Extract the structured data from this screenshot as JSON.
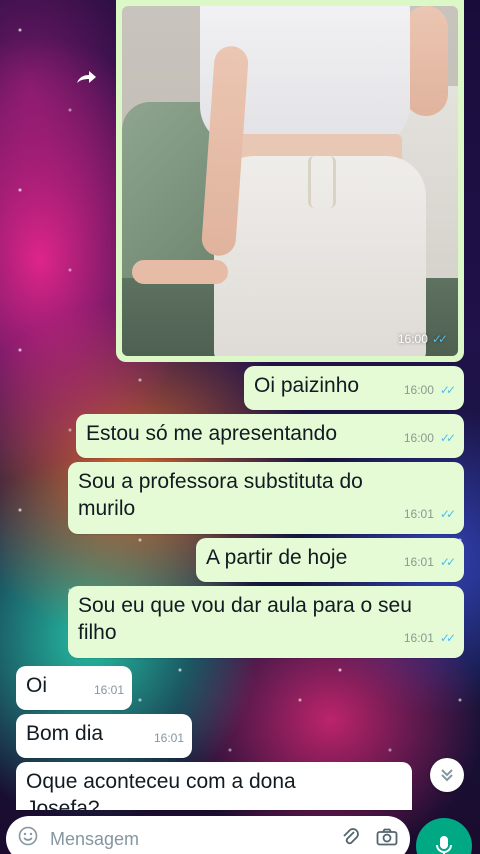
{
  "media_message": {
    "time": "16:00",
    "status_icon": "double-check-read-icon"
  },
  "messages": [
    {
      "direction": "out",
      "text": "Oi paizinho",
      "time": "16:00",
      "status": "read"
    },
    {
      "direction": "out",
      "text": "Estou só me apresentando",
      "time": "16:00",
      "status": "read"
    },
    {
      "direction": "out",
      "text": "Sou a professora substituta do murilo",
      "time": "16:01",
      "status": "read"
    },
    {
      "direction": "out",
      "text": "A partir de hoje",
      "time": "16:01",
      "status": "read"
    },
    {
      "direction": "out",
      "text": "Sou eu que vou dar aula para o seu filho",
      "time": "16:01",
      "status": "read"
    },
    {
      "direction": "in",
      "text": "Oi",
      "time": "16:01"
    },
    {
      "direction": "in",
      "text": "Bom dia",
      "time": "16:01"
    },
    {
      "direction": "in",
      "text": "Oque aconteceu com a dona Josefa?",
      "time": ""
    }
  ],
  "composer": {
    "placeholder": "Mensagem",
    "icons": [
      "emoji-icon",
      "attach-icon",
      "camera-icon",
      "mic-icon"
    ]
  },
  "colors": {
    "outgoing_bubble": "#e4fbd5",
    "incoming_bubble": "#ffffff",
    "read_ticks": "#53bdeb",
    "accent": "#00a884"
  }
}
